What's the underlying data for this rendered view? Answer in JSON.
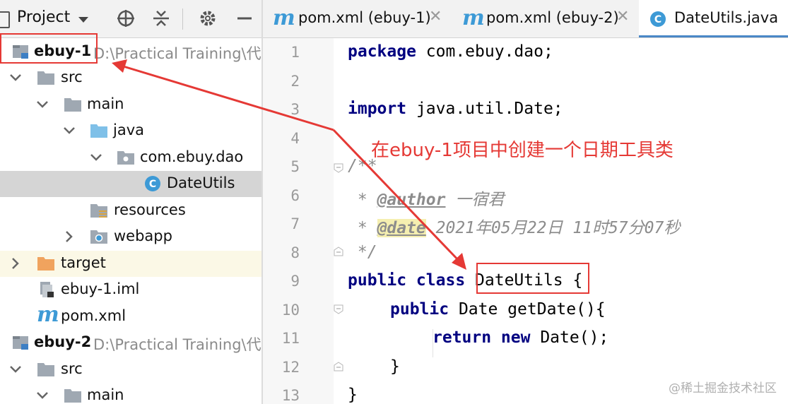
{
  "project_panel": {
    "title": "Project",
    "dropdown_icon": "caret-down",
    "toolbar_icons": [
      "locate-icon",
      "collapse-icon",
      "gear-icon",
      "minimize-icon"
    ]
  },
  "tree": [
    {
      "label": "ebuy-1",
      "path": "D:\\Practical Training\\代",
      "bold": true,
      "icon": "module-icon"
    },
    {
      "label": "src",
      "icon": "folder-icon"
    },
    {
      "label": "main",
      "icon": "folder-icon"
    },
    {
      "label": "java",
      "icon": "source-folder-icon"
    },
    {
      "label": "com.ebuy.dao",
      "icon": "package-icon"
    },
    {
      "label": "DateUtils",
      "icon": "class-icon"
    },
    {
      "label": "resources",
      "icon": "resources-folder-icon"
    },
    {
      "label": "webapp",
      "icon": "web-folder-icon"
    },
    {
      "label": "target",
      "icon": "excluded-folder-icon"
    },
    {
      "label": "ebuy-1.iml",
      "icon": "iml-file-icon"
    },
    {
      "label": "pom.xml",
      "icon": "maven-icon"
    },
    {
      "label": "ebuy-2",
      "path": "D:\\Practical Training\\代",
      "bold": true,
      "icon": "module-icon"
    },
    {
      "label": "src",
      "icon": "folder-icon"
    },
    {
      "label": "main",
      "icon": "folder-icon"
    }
  ],
  "tabs": [
    {
      "label": "pom.xml (ebuy-1)",
      "icon": "maven-icon"
    },
    {
      "label": "pom.xml (ebuy-2)",
      "icon": "maven-icon"
    },
    {
      "label": "DateUtils.java",
      "icon": "class-icon",
      "active": true
    }
  ],
  "code": {
    "line_numbers": [
      "1",
      "2",
      "3",
      "4",
      "5",
      "6",
      "7",
      "8",
      "9",
      "10",
      "11",
      "12",
      "13"
    ],
    "package_kw": "package",
    "package_name": " com.ebuy.dao;",
    "import_kw": "import",
    "import_name": " java.util.Date;",
    "doc_open": "/**",
    "author_prefix": " * ",
    "author_tag": "@author",
    "author_value": " 一宿君",
    "date_prefix": " * ",
    "date_tag": "@date",
    "date_value": " 2021年05月22日 11时57分07秒",
    "doc_close": " */",
    "class_kw": "public class",
    "class_name": "DateUtils",
    "class_brace": " {",
    "method_kw": "public",
    "method_rest": " Date getDate(){",
    "return_kw": "return new",
    "return_rest": " Date();",
    "method_close": "}",
    "class_close": "}"
  },
  "annotation": {
    "text": "在ebuy-1项目中创建一个日期工具类",
    "color": "#e53935"
  },
  "watermark": "@稀土掘金技术社区",
  "colors": {
    "keyword": "#000080",
    "comment": "#8c8c8c",
    "selection": "#d5d5d5",
    "active_tab_underline": "#4a88c7"
  }
}
